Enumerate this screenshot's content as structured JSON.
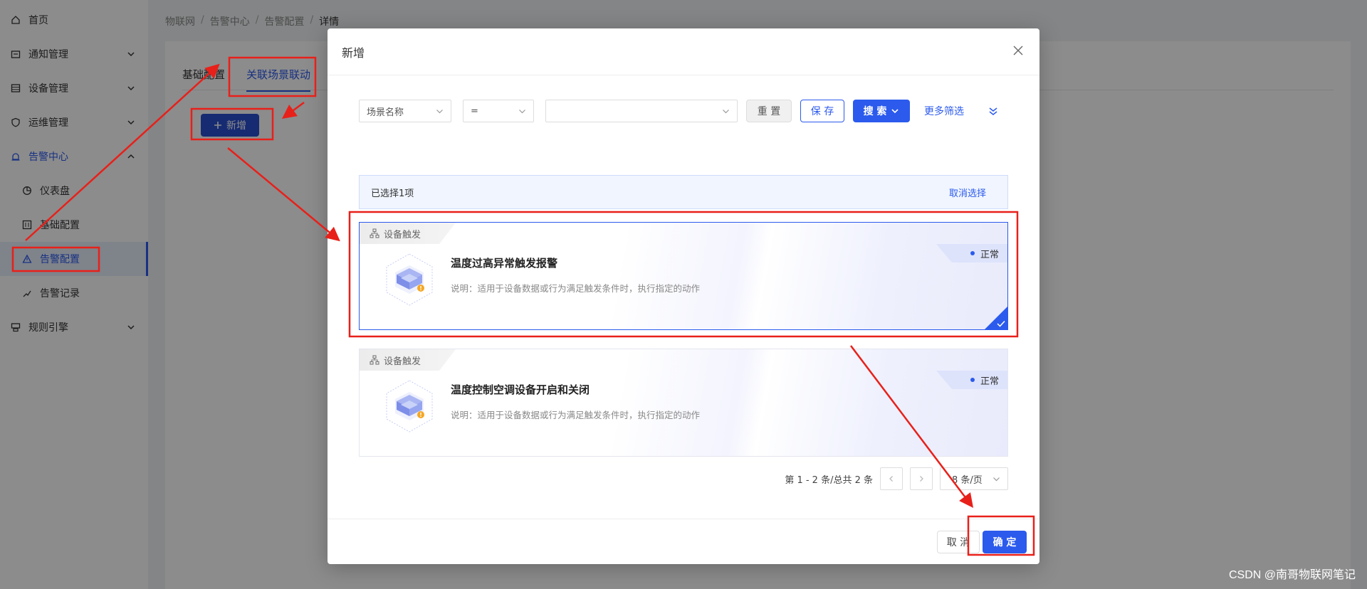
{
  "sidebar": {
    "items": [
      {
        "label": "首页"
      },
      {
        "label": "通知管理"
      },
      {
        "label": "设备管理"
      },
      {
        "label": "运维管理"
      },
      {
        "label": "告警中心"
      },
      {
        "label": "仪表盘"
      },
      {
        "label": "基础配置"
      },
      {
        "label": "告警配置"
      },
      {
        "label": "告警记录"
      },
      {
        "label": "规则引擎"
      }
    ]
  },
  "breadcrumb": [
    "物联网",
    "告警中心",
    "告警配置",
    "详情"
  ],
  "tabs": [
    {
      "label": "基础配置"
    },
    {
      "label": "关联场景联动"
    }
  ],
  "add_button": {
    "label": "新增"
  },
  "modal": {
    "title": "新增",
    "filter": {
      "field": "场景名称",
      "operator": "=",
      "value": "",
      "reset_label": "重 置",
      "save_label": "保 存",
      "search_label": "搜 索",
      "more_label": "更多筛选"
    },
    "selection": {
      "text": "已选择1项",
      "clear_label": "取消选择"
    },
    "cards": [
      {
        "tag": "设备触发",
        "title": "温度过高异常触发报警",
        "desc": "说明：适用于设备数据或行为满足触发条件时，执行指定的动作",
        "status": "正常",
        "selected": true
      },
      {
        "tag": "设备触发",
        "title": "温度控制空调设备开启和关闭",
        "desc": "说明：适用于设备数据或行为满足触发条件时，执行指定的动作",
        "status": "正常",
        "selected": false
      }
    ],
    "pagination": {
      "summary": "第 1 - 2 条/总共 2 条",
      "page_size": "8 条/页"
    },
    "footer": {
      "cancel_label": "取 消",
      "ok_label": "确 定"
    }
  },
  "watermark": "CSDN @南哥物联网笔记",
  "colors": {
    "primary": "#2b5aed",
    "annotation": "#e8201a"
  }
}
